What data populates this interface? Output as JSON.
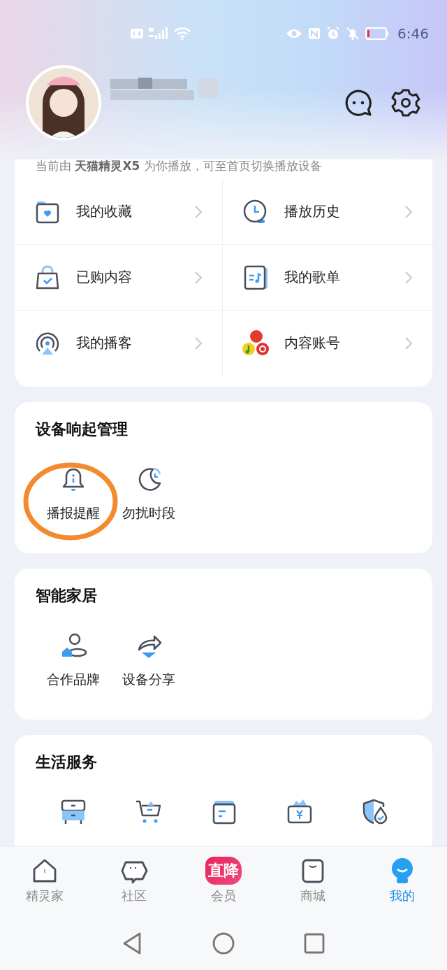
{
  "status_bar": {
    "time": "6:46"
  },
  "notice": "当前由 **天猫精灵X5** 为你播放，可至首页切换播放设备",
  "library": [
    {
      "label": "我的收藏"
    },
    {
      "label": "播放历史"
    },
    {
      "label": "已购内容"
    },
    {
      "label": "我的歌单"
    },
    {
      "label": "我的播客"
    },
    {
      "label": "内容账号"
    }
  ],
  "sections": [
    {
      "title": "设备响起管理",
      "items": [
        {
          "label": "播报提醒",
          "highlighted": true
        },
        {
          "label": "勿扰时段",
          "highlighted": false
        }
      ]
    },
    {
      "title": "智能家居",
      "items": [
        {
          "label": "合作品牌",
          "highlighted": false
        },
        {
          "label": "设备分享",
          "highlighted": false
        }
      ]
    },
    {
      "title": "生活服务",
      "items": [
        {
          "highlighted": false
        },
        {
          "highlighted": false
        },
        {
          "highlighted": false
        },
        {
          "highlighted": false
        },
        {
          "highlighted": false
        }
      ]
    }
  ],
  "tabs": [
    {
      "label": "精灵家",
      "selected": false
    },
    {
      "label": "社区",
      "selected": false
    },
    {
      "label": "会员",
      "selected": false,
      "badge": "直降"
    },
    {
      "label": "商城",
      "selected": false
    },
    {
      "label": "我的",
      "selected": true
    }
  ]
}
